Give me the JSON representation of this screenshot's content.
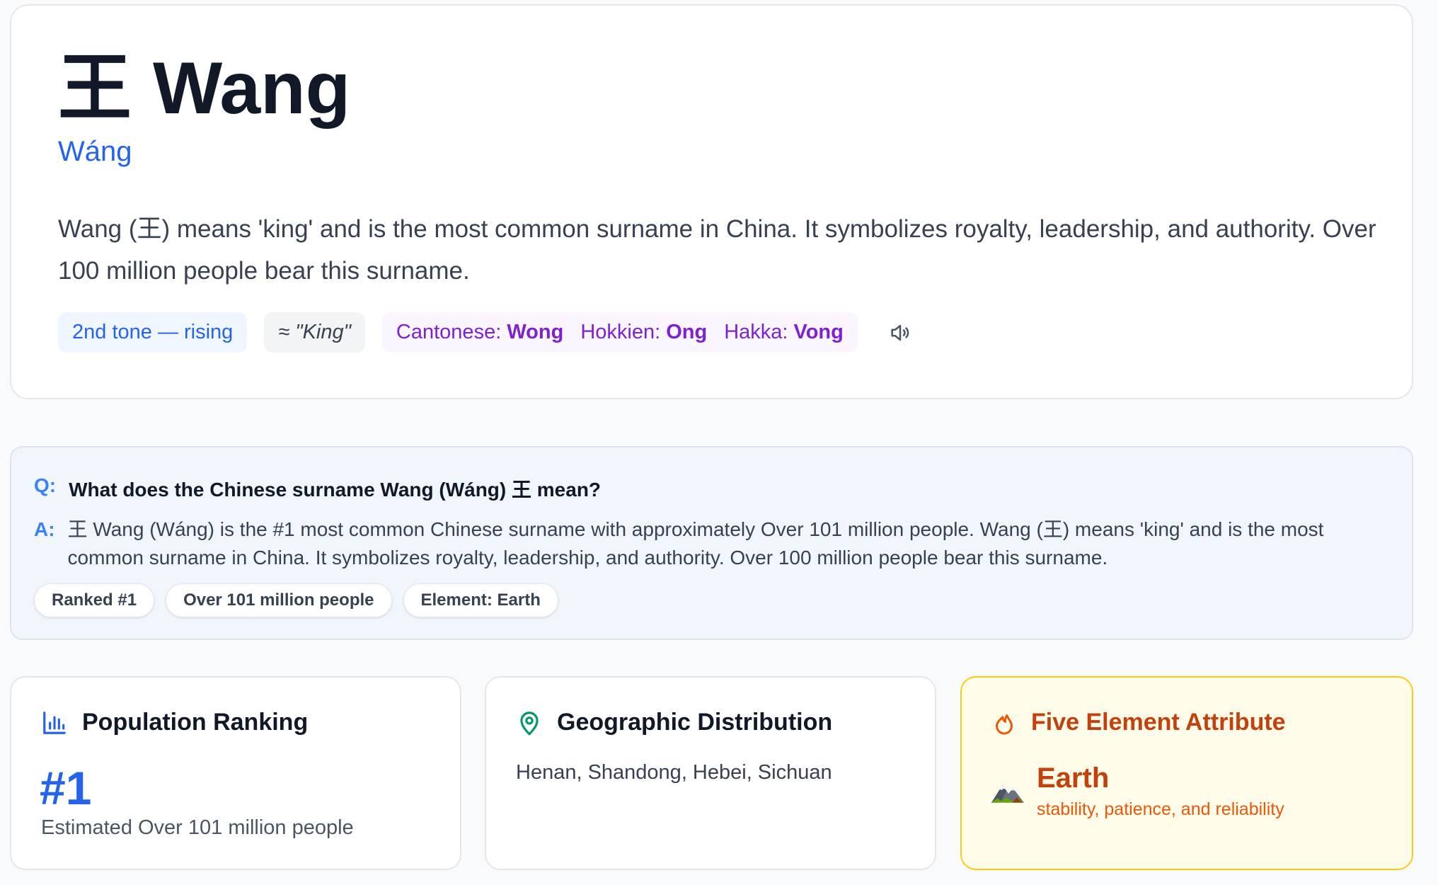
{
  "hero": {
    "character": "王",
    "name": "Wang",
    "pinyin": "Wáng",
    "meaning": "Wang (王) means 'king' and is the most common surname in China. It symbolizes royalty, leadership, and authority. Over 100 million people bear this surname.",
    "tone_tag": "2nd tone — rising",
    "approx_tag": "≈ \"King\"",
    "dialects": [
      {
        "label": "Cantonese:",
        "value": "Wong"
      },
      {
        "label": "Hokkien:",
        "value": "Ong"
      },
      {
        "label": "Hakka:",
        "value": "Vong"
      }
    ],
    "speaker_icon": "speaker-icon"
  },
  "faq": {
    "q_label": "Q:",
    "question": "What does the Chinese surname Wang (Wáng) 王 mean?",
    "a_label": "A:",
    "answer": "王 Wang (Wáng) is the #1 most common Chinese surname with approximately Over 101 million people. Wang (王) means 'king' and is the most common surname in China. It symbolizes royalty, leadership, and authority. Over 100 million people bear this surname.",
    "chips": [
      "Ranked #1",
      "Over 101 million people",
      "Element: Earth"
    ]
  },
  "cards": {
    "population": {
      "title": "Population Ranking",
      "icon": "bar-chart-icon",
      "rank": "#1",
      "subtitle": "Estimated Over 101 million people"
    },
    "geography": {
      "title": "Geographic Distribution",
      "icon": "map-pin-icon",
      "regions": "Henan, Shandong, Hebei, Sichuan"
    },
    "element": {
      "title": "Five Element Attribute",
      "icon": "flame-icon",
      "element_icon": "mountain-icon",
      "name": "Earth",
      "description": "stability, patience, and reliability"
    }
  },
  "colors": {
    "accent_blue": "#2563eb",
    "purple": "#7e22ce",
    "earth_orange": "#c2410c",
    "earth_card_bg": "#fefce8",
    "earth_card_border": "#facc15",
    "teal_pin": "#059669"
  }
}
